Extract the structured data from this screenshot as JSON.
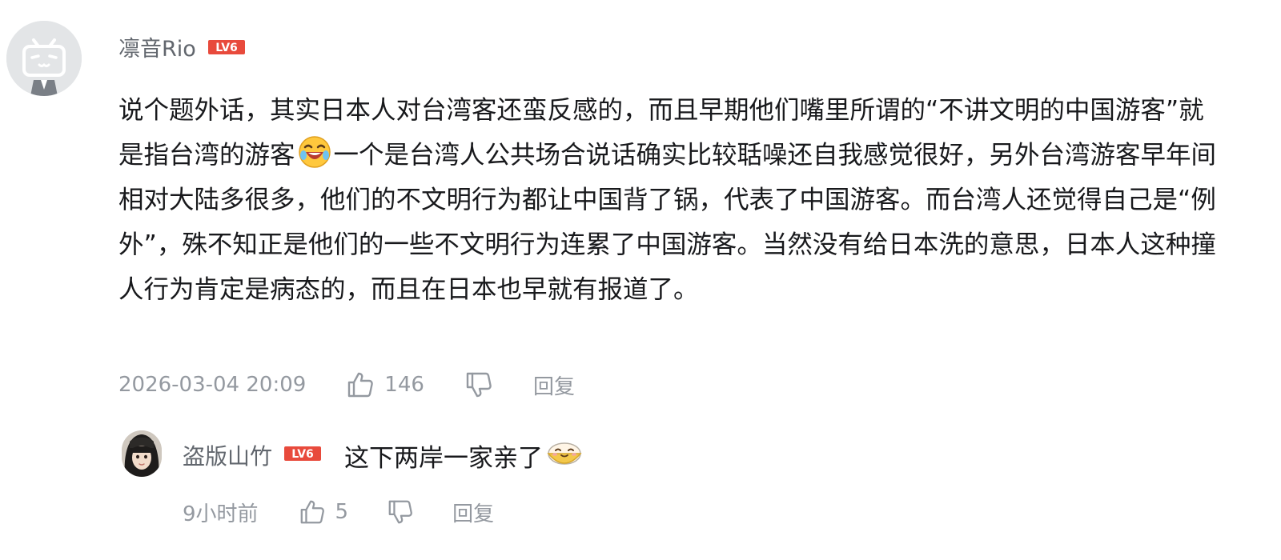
{
  "comment": {
    "username": "凛音Rio",
    "level": "LV6",
    "text_parts": [
      "说个题外话，其实日本人对台湾客还蛮反感的，而且早期他们嘴里所谓的“不讲文明的中国游客”就是指台湾的游客",
      "一个是台湾人公共场合说话确实比较聒噪还自我感觉很好，另外台湾游客早年间相对大陆多很多，他们的不文明行为都让中国背了锅，代表了中国游客。而台湾人还觉得自己是“例外”，殊不知正是他们的一些不文明行为连累了中国游客。当然没有给日本洗的意思，日本人这种撞人行为肯定是病态的，而且在日本也早就有报道了。"
    ],
    "inline_emoji": "laughing-crying-emoji",
    "timestamp": "2026-03-04 20:09",
    "like_count": "146",
    "reply_label": "回复"
  },
  "reply": {
    "username": "盗版山竹",
    "level": "LV6",
    "text": "这下两岸一家亲了",
    "emoji": "bowl-face-emoji",
    "timestamp": "9小时前",
    "like_count": "5",
    "reply_label": "回复"
  },
  "colors": {
    "username": "#61666d",
    "meta": "#9499a0",
    "text": "#18191c",
    "level_badge": "#e84a3c",
    "avatar_bg": "#e3e5e7"
  }
}
